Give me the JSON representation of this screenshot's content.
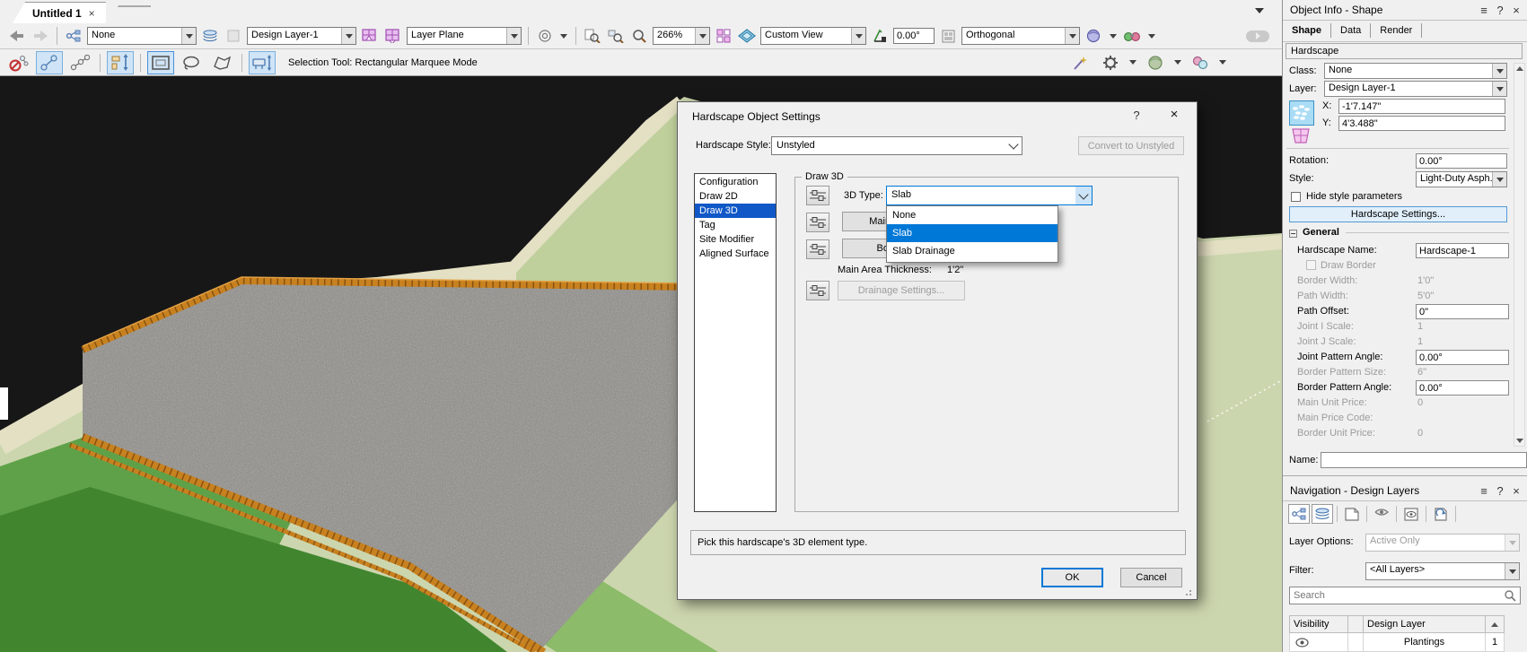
{
  "icons": {
    "close": "×",
    "menu": "≡",
    "help": "?"
  },
  "colors": {
    "selection_blue": "#1058c7",
    "highlight_blue": "#0078d7",
    "settings_button_blue": "#e1effb"
  },
  "tab_bar": {
    "active_tab": "Untitled 1"
  },
  "toolbar_primary": {
    "tool_preset": "None",
    "active_layer": "Design Layer-1",
    "active_plane": "Layer Plane",
    "zoom_level": "266%",
    "current_view": "Custom View",
    "rotation_angle": "0.00°",
    "projection": "Orthogonal"
  },
  "toolbar_mode": {
    "status_text": "Selection Tool: Rectangular Marquee Mode"
  },
  "viewport": {
    "terrain_light_green": "#ccd6ae",
    "terrain_dark_green": "#41862f",
    "terrain_bright_green": "#5fa149",
    "terrain_tan": "#e4e0c4",
    "path_gray": "#8e8c87",
    "fence_orange": "#c8811f"
  },
  "dialog": {
    "title": "Hardscape Object Settings",
    "style_label": "Hardscape Style:",
    "style_value": "Unstyled",
    "convert_button": "Convert to Unstyled",
    "nav_items": [
      "Configuration",
      "Draw 2D",
      "Draw 3D",
      "Tag",
      "Site Modifier",
      "Aligned Surface"
    ],
    "selected_nav": "Draw 3D",
    "group_title": "Draw 3D",
    "type_label": "3D Type:",
    "type_value": "Slab",
    "type_options": [
      "None",
      "Slab",
      "Slab Drainage"
    ],
    "selected_option": "Slab",
    "main_area_button": "Main Area Settings...",
    "border_button": "Border Settings...",
    "thickness_label": "Main Area Thickness:",
    "thickness_value": "1'2\"",
    "drainage_button": "Drainage Settings...",
    "description": "Pick this hardscape's 3D element type.",
    "ok_button": "OK",
    "cancel_button": "Cancel"
  },
  "object_info": {
    "title": "Object Info - Shape",
    "tabs": [
      "Shape",
      "Data",
      "Render"
    ],
    "active_tab": "Shape",
    "object_type": "Hardscape",
    "class_label": "Class:",
    "class_value": "None",
    "layer_label": "Layer:",
    "layer_value": "Design Layer-1",
    "x_label": "X:",
    "x_value": "-1'7.147\"",
    "y_label": "Y:",
    "y_value": "4'3.488\"",
    "rotation_label": "Rotation:",
    "rotation_value": "0.00°",
    "style_label": "Style:",
    "style_value": "Light-Duty Asph...",
    "hide_style_label": "Hide style parameters",
    "settings_button": "Hardscape Settings...",
    "general_section": "General",
    "params": [
      {
        "label": "Hardscape Name:",
        "value": "Hardscape-1",
        "kind": "field"
      },
      {
        "label": "Draw Border",
        "value": "",
        "kind": "checkbox-disabled"
      },
      {
        "label": "Border Width:",
        "value": "1'0\"",
        "kind": "readonly"
      },
      {
        "label": "Path Width:",
        "value": "5'0\"",
        "kind": "readonly"
      },
      {
        "label": "Path Offset:",
        "value": "0\"",
        "kind": "field"
      },
      {
        "label": "Joint I Scale:",
        "value": "1",
        "kind": "readonly"
      },
      {
        "label": "Joint J Scale:",
        "value": "1",
        "kind": "readonly"
      },
      {
        "label": "Joint Pattern Angle:",
        "value": "0.00°",
        "kind": "field"
      },
      {
        "label": "Border Pattern Size:",
        "value": "6\"",
        "kind": "readonly"
      },
      {
        "label": "Border Pattern Angle:",
        "value": "0.00°",
        "kind": "field"
      },
      {
        "label": "Main Unit Price:",
        "value": "0",
        "kind": "readonly"
      },
      {
        "label": "Main Price Code:",
        "value": "",
        "kind": "readonly"
      },
      {
        "label": "Border Unit Price:",
        "value": "0",
        "kind": "readonly"
      }
    ],
    "name_label": "Name:",
    "name_value": ""
  },
  "navigation": {
    "title": "Navigation - Design Layers",
    "layer_options_label": "Layer Options:",
    "layer_options_value": "Active Only",
    "filter_label": "Filter:",
    "filter_value": "<All Layers>",
    "search_placeholder": "Search",
    "table": {
      "headers": [
        "Visibility",
        "Design Layer"
      ],
      "rows": [
        {
          "name": "Plantings",
          "order": "1"
        }
      ]
    }
  }
}
